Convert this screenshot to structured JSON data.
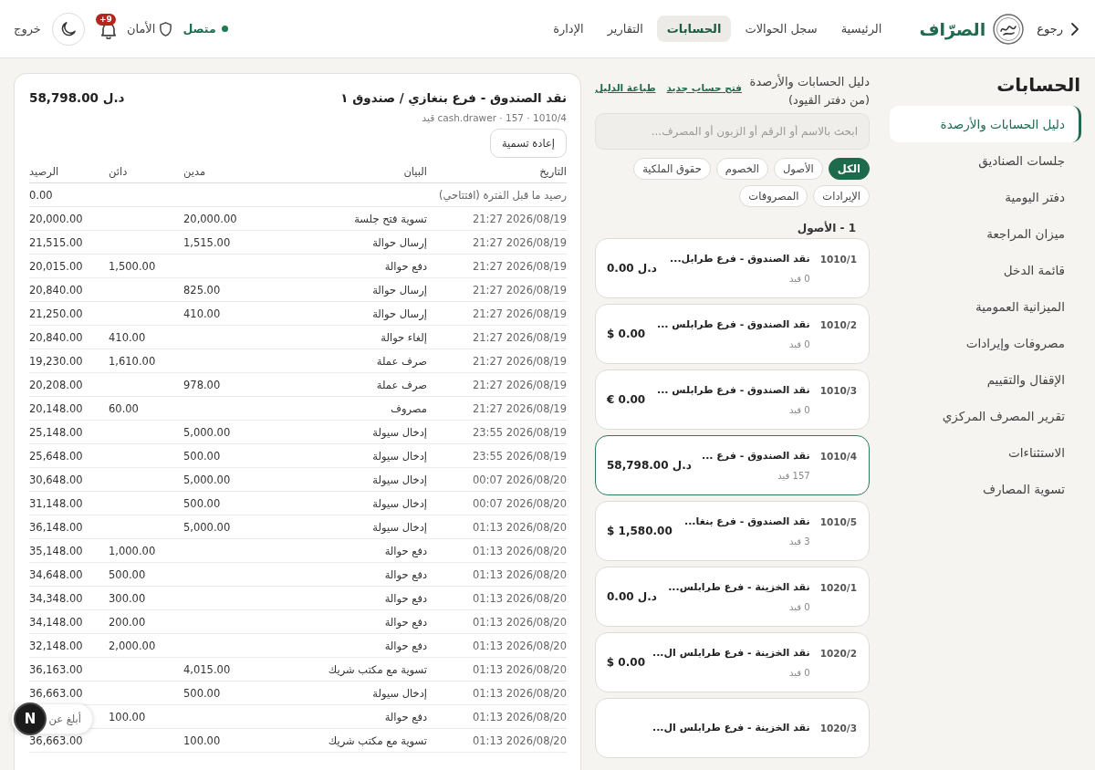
{
  "topbar": {
    "back": "رجوع",
    "brand": "الصرّاف",
    "nav": [
      {
        "label": "الرئيسية",
        "selected": false
      },
      {
        "label": "سجل الحوالات",
        "selected": false
      },
      {
        "label": "الحسابات",
        "selected": true
      },
      {
        "label": "التقارير",
        "selected": false
      },
      {
        "label": "الإدارة",
        "selected": false
      }
    ],
    "status": {
      "label": "متصل",
      "online": true
    },
    "security": "الأمان",
    "notifications": "+9",
    "logout": "خروج"
  },
  "sidebar": {
    "title": "الحسابات",
    "items": [
      {
        "label": "دليل الحسابات والأرصدة",
        "selected": true
      },
      {
        "label": "جلسات الصناديق",
        "selected": false
      },
      {
        "label": "دفتر اليومية",
        "selected": false
      },
      {
        "label": "ميزان المراجعة",
        "selected": false
      },
      {
        "label": "قائمة الدخل",
        "selected": false
      },
      {
        "label": "الميزانية العمومية",
        "selected": false
      },
      {
        "label": "مصروفات وإيرادات",
        "selected": false
      },
      {
        "label": "الإقفال والتقييم",
        "selected": false
      },
      {
        "label": "تقرير المصرف المركزي",
        "selected": false
      },
      {
        "label": "الاستثناءات",
        "selected": false
      },
      {
        "label": "تسوية المصارف",
        "selected": false
      }
    ]
  },
  "chart_of_accounts": {
    "title": "دليل الحسابات والأرصدة",
    "subtitle": "(من دفتر القيود)",
    "new_account_link": "فتح حساب جديد",
    "print_link": "طباعة الدليل",
    "search": {
      "placeholder": "ابحث بالاسم أو الرقم أو الزبون أو المصرف..."
    },
    "filters": [
      {
        "label": "الكل",
        "selected": true
      },
      {
        "label": "الأصول",
        "selected": false
      },
      {
        "label": "الخصوم",
        "selected": false
      },
      {
        "label": "حقوق الملكية",
        "selected": false
      },
      {
        "label": "الإيرادات",
        "selected": false
      },
      {
        "label": "المصروفات",
        "selected": false
      }
    ],
    "group": "1 - الأصول",
    "accounts": [
      {
        "code": "1010/1",
        "name": "نقد الصندوق - فرع طرابل...",
        "entries": "0 قيد",
        "balance": "0.00 د.ل",
        "selected": false
      },
      {
        "code": "1010/2",
        "name": "نقد الصندوق - فرع طرابلس ...",
        "entries": "0 قيد",
        "balance": "$ 0.00",
        "selected": false
      },
      {
        "code": "1010/3",
        "name": "نقد الصندوق - فرع طرابلس ...",
        "entries": "0 قيد",
        "balance": "€ 0.00",
        "selected": false
      },
      {
        "code": "1010/4",
        "name": "نقد الصندوق - فرع ...",
        "entries": "157 قيد",
        "balance": "58,798.00 د.ل",
        "selected": true
      },
      {
        "code": "1010/5",
        "name": "نقد الصندوق - فرع بنغا...",
        "entries": "3 قيد",
        "balance": "$ 1,580.00",
        "selected": false
      },
      {
        "code": "1020/1",
        "name": "نقد الخزينة - فرع طرابلس...",
        "entries": "0 قيد",
        "balance": "0.00 د.ل",
        "selected": false
      },
      {
        "code": "1020/2",
        "name": "نقد الخزينة - فرع طرابلس ال...",
        "entries": "0 قيد",
        "balance": "$ 0.00",
        "selected": false
      },
      {
        "code": "1020/3",
        "name": "نقد الخزينة - فرع طرابلس ال...",
        "selected": false
      }
    ]
  },
  "ledger": {
    "title": "نقد الصندوق - فرع بنغازي / صندوق ١",
    "balance": "58,798.00 د.ل",
    "meta": "1010/4 · 157 · cash.drawer قيد",
    "rename": "إعادة تسمية",
    "columns": [
      "التاريخ",
      "البيان",
      "مدين",
      "دائن",
      "الرصيد"
    ],
    "rows": [
      {
        "kind": "opening",
        "label": "رصيد ما قبل الفترة (افتتاحي)",
        "balance": "0.00"
      },
      {
        "kind": "entry",
        "date": "2026/08/19 21:27",
        "description": "تسوية فتح جلسة",
        "debit": "20,000.00",
        "balance": "20,000.00"
      },
      {
        "kind": "entry",
        "date": "2026/08/19 21:27",
        "description": "إرسال حوالة",
        "debit": "1,515.00",
        "balance": "21,515.00"
      },
      {
        "kind": "entry",
        "date": "2026/08/19 21:27",
        "description": "دفع حوالة",
        "credit": "1,500.00",
        "balance": "20,015.00"
      },
      {
        "kind": "entry",
        "date": "2026/08/19 21:27",
        "description": "إرسال حوالة",
        "debit": "825.00",
        "balance": "20,840.00"
      },
      {
        "kind": "entry",
        "date": "2026/08/19 21:27",
        "description": "إرسال حوالة",
        "debit": "410.00",
        "balance": "21,250.00"
      },
      {
        "kind": "entry",
        "date": "2026/08/19 21:27",
        "description": "إلغاء حوالة",
        "credit": "410.00",
        "balance": "20,840.00"
      },
      {
        "kind": "entry",
        "date": "2026/08/19 21:27",
        "description": "صرف عملة",
        "credit": "1,610.00",
        "balance": "19,230.00"
      },
      {
        "kind": "entry",
        "date": "2026/08/19 21:27",
        "description": "صرف عملة",
        "debit": "978.00",
        "balance": "20,208.00"
      },
      {
        "kind": "entry",
        "date": "2026/08/19 21:27",
        "description": "مصروف",
        "credit": "60.00",
        "balance": "20,148.00"
      },
      {
        "kind": "entry",
        "date": "2026/08/19 23:55",
        "description": "إدخال سيولة",
        "debit": "5,000.00",
        "balance": "25,148.00"
      },
      {
        "kind": "entry",
        "date": "2026/08/19 23:55",
        "description": "إدخال سيولة",
        "debit": "500.00",
        "balance": "25,648.00"
      },
      {
        "kind": "entry",
        "date": "2026/08/20 00:07",
        "description": "إدخال سيولة",
        "debit": "5,000.00",
        "balance": "30,648.00"
      },
      {
        "kind": "entry",
        "date": "2026/08/20 00:07",
        "description": "إدخال سيولة",
        "debit": "500.00",
        "balance": "31,148.00"
      },
      {
        "kind": "entry",
        "date": "2026/08/20 01:13",
        "description": "إدخال سيولة",
        "debit": "5,000.00",
        "balance": "36,148.00"
      },
      {
        "kind": "entry",
        "date": "2026/08/20 01:13",
        "description": "دفع حوالة",
        "credit": "1,000.00",
        "balance": "35,148.00"
      },
      {
        "kind": "entry",
        "date": "2026/08/20 01:13",
        "description": "دفع حوالة",
        "credit": "500.00",
        "balance": "34,648.00"
      },
      {
        "kind": "entry",
        "date": "2026/08/20 01:13",
        "description": "دفع حوالة",
        "credit": "300.00",
        "balance": "34,348.00"
      },
      {
        "kind": "entry",
        "date": "2026/08/20 01:13",
        "description": "دفع حوالة",
        "credit": "200.00",
        "balance": "34,148.00"
      },
      {
        "kind": "entry",
        "date": "2026/08/20 01:13",
        "description": "دفع حوالة",
        "credit": "2,000.00",
        "balance": "32,148.00"
      },
      {
        "kind": "entry",
        "date": "2026/08/20 01:13",
        "description": "تسوية مع مكتب شريك",
        "debit": "4,015.00",
        "balance": "36,163.00"
      },
      {
        "kind": "entry",
        "date": "2026/08/20 01:13",
        "description": "إدخال سيولة",
        "debit": "500.00",
        "balance": "36,663.00"
      },
      {
        "kind": "entry",
        "date": "2026/08/20 01:13",
        "description": "دفع حوالة",
        "credit": "100.00"
      },
      {
        "kind": "entry",
        "date": "2026/08/20 01:13",
        "description": "تسوية مع مكتب شريك",
        "debit": "100.00",
        "balance": "36,663.00"
      }
    ]
  },
  "dev_overlay": {
    "badge": "N",
    "report": "أبلغ عن"
  }
}
